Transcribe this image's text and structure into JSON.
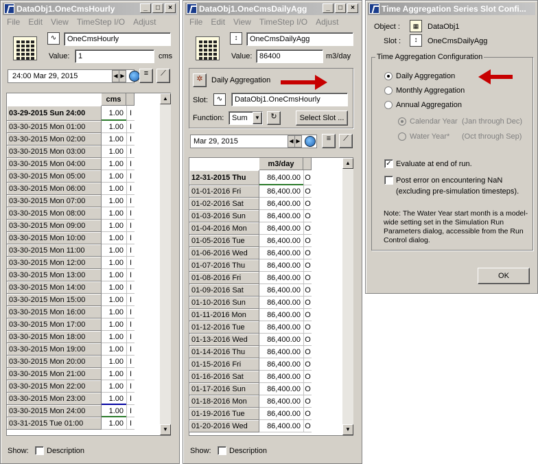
{
  "win1": {
    "title": "DataObj1.OneCmsHourly",
    "menu": [
      "File",
      "Edit",
      "View",
      "TimeStep I/O",
      "Adjust"
    ],
    "slot_name": "OneCmsHourly",
    "value_label": "Value:",
    "value": "1",
    "units": "cms",
    "date": "24:00 Mar 29, 2015",
    "col_header": "cms",
    "rows": [
      [
        "03-29-2015 Sun 24:00",
        "1.00",
        "I"
      ],
      [
        "03-30-2015 Mon 01:00",
        "1.00",
        "I"
      ],
      [
        "03-30-2015 Mon 02:00",
        "1.00",
        "I"
      ],
      [
        "03-30-2015 Mon 03:00",
        "1.00",
        "I"
      ],
      [
        "03-30-2015 Mon 04:00",
        "1.00",
        "I"
      ],
      [
        "03-30-2015 Mon 05:00",
        "1.00",
        "I"
      ],
      [
        "03-30-2015 Mon 06:00",
        "1.00",
        "I"
      ],
      [
        "03-30-2015 Mon 07:00",
        "1.00",
        "I"
      ],
      [
        "03-30-2015 Mon 08:00",
        "1.00",
        "I"
      ],
      [
        "03-30-2015 Mon 09:00",
        "1.00",
        "I"
      ],
      [
        "03-30-2015 Mon 10:00",
        "1.00",
        "I"
      ],
      [
        "03-30-2015 Mon 11:00",
        "1.00",
        "I"
      ],
      [
        "03-30-2015 Mon 12:00",
        "1.00",
        "I"
      ],
      [
        "03-30-2015 Mon 13:00",
        "1.00",
        "I"
      ],
      [
        "03-30-2015 Mon 14:00",
        "1.00",
        "I"
      ],
      [
        "03-30-2015 Mon 15:00",
        "1.00",
        "I"
      ],
      [
        "03-30-2015 Mon 16:00",
        "1.00",
        "I"
      ],
      [
        "03-30-2015 Mon 17:00",
        "1.00",
        "I"
      ],
      [
        "03-30-2015 Mon 18:00",
        "1.00",
        "I"
      ],
      [
        "03-30-2015 Mon 19:00",
        "1.00",
        "I"
      ],
      [
        "03-30-2015 Mon 20:00",
        "1.00",
        "I"
      ],
      [
        "03-30-2015 Mon 21:00",
        "1.00",
        "I"
      ],
      [
        "03-30-2015 Mon 22:00",
        "1.00",
        "I"
      ],
      [
        "03-30-2015 Mon 23:00",
        "1.00",
        "I"
      ],
      [
        "03-30-2015 Mon 24:00",
        "1.00",
        "I"
      ],
      [
        "03-31-2015 Tue 01:00",
        "1.00",
        "I"
      ]
    ],
    "show_label": "Show:",
    "desc_label": "Description"
  },
  "win2": {
    "title": "DataObj1.OneCmsDailyAgg",
    "menu": [
      "File",
      "Edit",
      "View",
      "TimeStep I/O",
      "Adjust"
    ],
    "slot_name": "OneCmsDailyAgg",
    "value_label": "Value:",
    "value": "86400",
    "units": "m3/day",
    "agg_label": "Daily Aggregation",
    "slot_label": "Slot:",
    "slot_value": "DataObj1.OneCmsHourly",
    "function_label": "Function:",
    "function_value": "Sum",
    "select_slot": "Select Slot ...",
    "date": "Mar 29, 2015",
    "col_header": "m3/day",
    "rows": [
      [
        "12-31-2015 Thu",
        "86,400.00",
        "O"
      ],
      [
        "01-01-2016 Fri",
        "86,400.00",
        "O"
      ],
      [
        "01-02-2016 Sat",
        "86,400.00",
        "O"
      ],
      [
        "01-03-2016 Sun",
        "86,400.00",
        "O"
      ],
      [
        "01-04-2016 Mon",
        "86,400.00",
        "O"
      ],
      [
        "01-05-2016 Tue",
        "86,400.00",
        "O"
      ],
      [
        "01-06-2016 Wed",
        "86,400.00",
        "O"
      ],
      [
        "01-07-2016 Thu",
        "86,400.00",
        "O"
      ],
      [
        "01-08-2016 Fri",
        "86,400.00",
        "O"
      ],
      [
        "01-09-2016 Sat",
        "86,400.00",
        "O"
      ],
      [
        "01-10-2016 Sun",
        "86,400.00",
        "O"
      ],
      [
        "01-11-2016 Mon",
        "86,400.00",
        "O"
      ],
      [
        "01-12-2016 Tue",
        "86,400.00",
        "O"
      ],
      [
        "01-13-2016 Wed",
        "86,400.00",
        "O"
      ],
      [
        "01-14-2016 Thu",
        "86,400.00",
        "O"
      ],
      [
        "01-15-2016 Fri",
        "86,400.00",
        "O"
      ],
      [
        "01-16-2016 Sat",
        "86,400.00",
        "O"
      ],
      [
        "01-17-2016 Sun",
        "86,400.00",
        "O"
      ],
      [
        "01-18-2016 Mon",
        "86,400.00",
        "O"
      ],
      [
        "01-19-2016 Tue",
        "86,400.00",
        "O"
      ],
      [
        "01-20-2016 Wed",
        "86,400.00",
        "O"
      ]
    ],
    "show_label": "Show:",
    "desc_label": "Description"
  },
  "win3": {
    "title": "Time Aggregation Series Slot Confi...",
    "object_label": "Object :",
    "object_value": "DataObj1",
    "slot_label": "Slot :",
    "slot_value": "OneCmsDailyAgg",
    "group_title": "Time Aggregation Configuration",
    "daily": "Daily Aggregation",
    "monthly": "Monthly Aggregation",
    "annual": "Annual Aggregation",
    "calendar_year": "Calendar Year",
    "calendar_note": "(Jan through Dec)",
    "water_year": "Water Year*",
    "water_note": "(Oct through Sep)",
    "evaluate": "Evaluate at end of run.",
    "post_error_1": "Post error on encountering NaN",
    "post_error_2": "(excluding pre-simulation timesteps).",
    "note": "Note: The Water Year start month is a model-wide setting set in the Simulation Run Parameters dialog, accessible from the Run Control dialog.",
    "ok": "OK"
  },
  "colors": {
    "arrow": "#c70000",
    "title_inactive": "#9b9b9b",
    "window_bg": "#d4d0c8"
  }
}
